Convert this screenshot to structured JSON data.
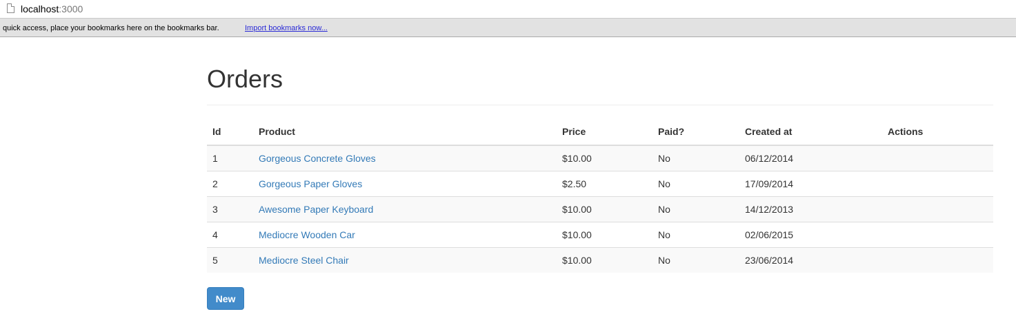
{
  "browser": {
    "url_host": "localhost",
    "url_port": ":3000",
    "bookmarks_message": "quick access, place your bookmarks here on the bookmarks bar.",
    "import_link": "Import bookmarks now..."
  },
  "page": {
    "title": "Orders",
    "new_button": "New"
  },
  "table": {
    "headers": {
      "id": "Id",
      "product": "Product",
      "price": "Price",
      "paid": "Paid?",
      "created": "Created at",
      "actions": "Actions"
    },
    "rows": [
      {
        "id": "1",
        "product": "Gorgeous Concrete Gloves",
        "price": "$10.00",
        "paid": "No",
        "created": "06/12/2014",
        "actions": ""
      },
      {
        "id": "2",
        "product": "Gorgeous Paper Gloves",
        "price": "$2.50",
        "paid": "No",
        "created": "17/09/2014",
        "actions": ""
      },
      {
        "id": "3",
        "product": "Awesome Paper Keyboard",
        "price": "$10.00",
        "paid": "No",
        "created": "14/12/2013",
        "actions": ""
      },
      {
        "id": "4",
        "product": "Mediocre Wooden Car",
        "price": "$10.00",
        "paid": "No",
        "created": "02/06/2015",
        "actions": ""
      },
      {
        "id": "5",
        "product": "Mediocre Steel Chair",
        "price": "$10.00",
        "paid": "No",
        "created": "23/06/2014",
        "actions": ""
      }
    ]
  },
  "colors": {
    "link": "#337ab7",
    "primary_button": "#428bca",
    "striped_row": "#f9f9f9"
  }
}
